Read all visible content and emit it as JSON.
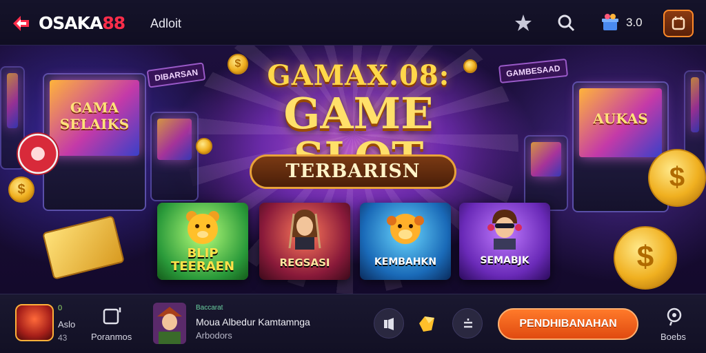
{
  "header": {
    "brand_name": "OSAKA",
    "brand_number": "88",
    "link_label": "Adloit",
    "balance": "3.0",
    "icons": [
      "back-arrow-icon",
      "star-icon",
      "search-icon",
      "gift-box-icon",
      "menu-icon"
    ]
  },
  "hero": {
    "headline_top": "GAMAX.08:",
    "headline_main": "GAME SLOT",
    "ribbon": "TERBARISN",
    "left_machine_title": "GAMA SELAIKS",
    "right_machine_title": "AUKAS",
    "left_sign": "DIBARSAN",
    "right_sign": "GAMBESAAD",
    "cards": [
      {
        "label": "BLIP TEERAEN",
        "icon": "bear-icon"
      },
      {
        "label": "REGSASI",
        "icon": "rockstar-icon"
      },
      {
        "label": "KEMBAHKN",
        "icon": "creature-icon"
      },
      {
        "label": "SEMABJK",
        "icon": "gamer-icon"
      }
    ]
  },
  "bottombar": {
    "left_badge_value": "0",
    "left_label": "Aslo",
    "left_sub": "43",
    "promo_label": "Poranmos",
    "game_tag": "Baccarat",
    "game_title": "Moua Albedur Kamtamnga",
    "game_sub": "Arbodors",
    "cta_label": "PENDHIBANAHAN",
    "right_label": "Boebs",
    "colors": {
      "accent": "#ff6a1a",
      "brand_red": "#ff2d4a",
      "gold": "#ffd84a"
    }
  }
}
